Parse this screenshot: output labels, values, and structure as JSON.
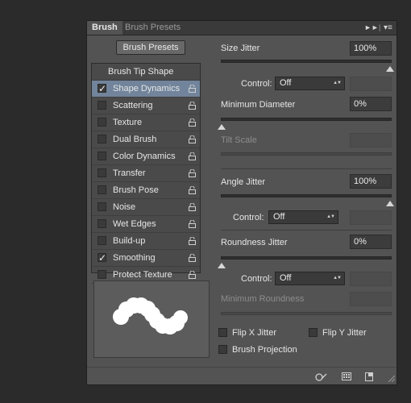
{
  "tabs": [
    {
      "label": "Brush",
      "active": true
    },
    {
      "label": "Brush Presets",
      "active": false
    }
  ],
  "brush_presets_button": "Brush Presets",
  "list_header": "Brush Tip Shape",
  "list_items": [
    {
      "label": "Shape Dynamics",
      "checked": true,
      "selected": true
    },
    {
      "label": "Scattering",
      "checked": false
    },
    {
      "label": "Texture",
      "checked": false
    },
    {
      "label": "Dual Brush",
      "checked": false
    },
    {
      "label": "Color Dynamics",
      "checked": false
    },
    {
      "label": "Transfer",
      "checked": false
    },
    {
      "label": "Brush Pose",
      "checked": false
    },
    {
      "label": "Noise",
      "checked": false
    },
    {
      "label": "Wet Edges",
      "checked": false
    },
    {
      "label": "Build-up",
      "checked": false
    },
    {
      "label": "Smoothing",
      "checked": true
    },
    {
      "label": "Protect Texture",
      "checked": false
    }
  ],
  "settings": {
    "size_jitter": {
      "label": "Size Jitter",
      "value": "100%",
      "slider": 1.0
    },
    "control1": {
      "label": "Control:",
      "value": "Off"
    },
    "min_diameter": {
      "label": "Minimum Diameter",
      "value": "0%",
      "slider": 0.0
    },
    "tilt_scale": {
      "label": "Tilt Scale",
      "value": ""
    },
    "angle_jitter": {
      "label": "Angle Jitter",
      "value": "100%",
      "slider": 1.0
    },
    "control2": {
      "label": "Control:",
      "value": "Off"
    },
    "roundness_jitter": {
      "label": "Roundness Jitter",
      "value": "0%",
      "slider": 0.0
    },
    "control3": {
      "label": "Control:",
      "value": "Off"
    },
    "min_roundness": {
      "label": "Minimum Roundness",
      "value": ""
    },
    "flip_x": {
      "label": "Flip X Jitter",
      "checked": false
    },
    "flip_y": {
      "label": "Flip Y Jitter",
      "checked": false
    },
    "brush_projection": {
      "label": "Brush Projection",
      "checked": false
    }
  },
  "footer_icons": [
    "toggle-live-tip-icon",
    "create-new-brush-icon"
  ],
  "colors": {
    "selected_row": "#71849b",
    "panel": "#535353"
  }
}
